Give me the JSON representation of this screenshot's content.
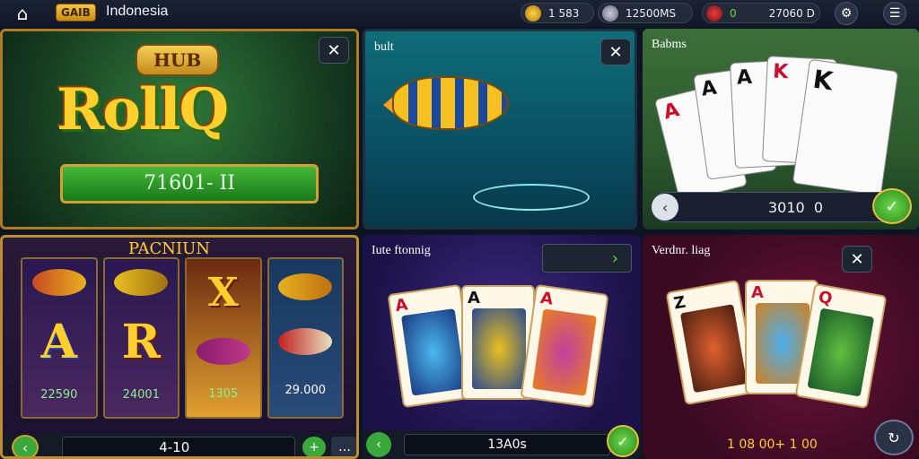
{
  "topbar": {
    "home_icon": "home-icon",
    "brand": "GAIB",
    "region": "Indonesia",
    "balance_1": "1   583",
    "balance_2": "12500MS",
    "balance_3_prefix": "0",
    "balance_3": "27060 D"
  },
  "panels": {
    "p1": {
      "badge": "HUB",
      "logo": "RollQ",
      "bar_text": "71601- II"
    },
    "p2": {
      "title": "bult"
    },
    "p3": {
      "title": "Babms",
      "slider_value": "3010  0",
      "cards": [
        "A",
        "A",
        "A",
        "K",
        "K"
      ]
    },
    "p4": {
      "title": "PACNIUN",
      "reel_values": [
        "22590",
        "24001",
        "1305",
        "29.000"
      ],
      "bottom_value": "4-10  "
    },
    "p5": {
      "title": "Iute ftonnig",
      "bottom_value": "13A0s"
    },
    "p6": {
      "title": "Verdnr. liag",
      "bottom_value": "1 08 00+ 1 00"
    }
  },
  "colors": {
    "accent_green": "#3aa83a",
    "gold": "#ffcf2e",
    "frame": "#c08c30"
  }
}
